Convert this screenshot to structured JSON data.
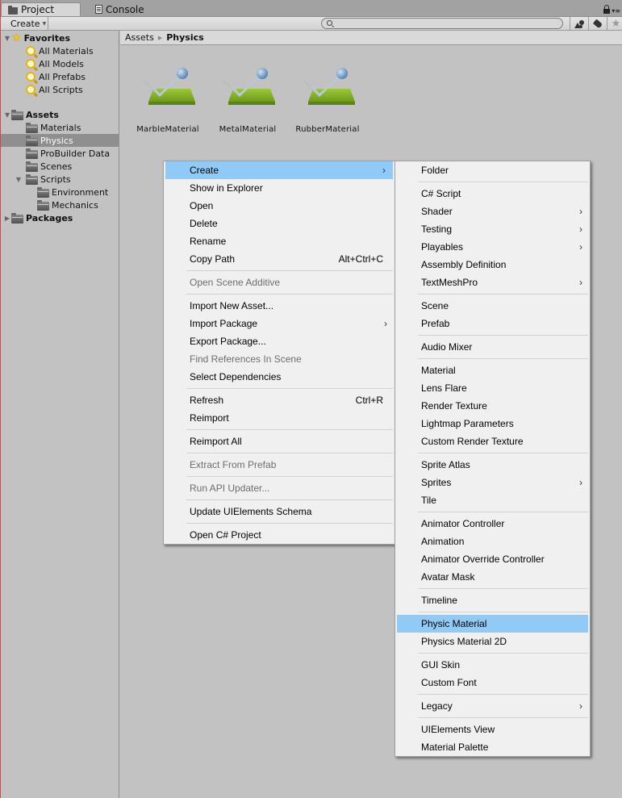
{
  "tabs": [
    {
      "label": "Project",
      "icon": "folder-icon",
      "active": true
    },
    {
      "label": "Console",
      "icon": "console-icon",
      "active": false
    }
  ],
  "toolbar": {
    "create_label": "Create",
    "search_placeholder": "",
    "buttons": [
      "search-by-type-icon",
      "search-by-label-icon",
      "favorite-star-icon"
    ]
  },
  "sidebar": {
    "favorites": {
      "label": "Favorites",
      "items": [
        "All Materials",
        "All Models",
        "All Prefabs",
        "All Scripts"
      ]
    },
    "assets": {
      "label": "Assets",
      "items": [
        {
          "label": "Materials"
        },
        {
          "label": "Physics",
          "selected": true
        },
        {
          "label": "ProBuilder Data"
        },
        {
          "label": "Scenes"
        },
        {
          "label": "Scripts",
          "expanded": true,
          "children": [
            "Environment",
            "Mechanics"
          ]
        }
      ]
    },
    "packages": {
      "label": "Packages"
    }
  },
  "breadcrumb": {
    "root": "Assets",
    "current": "Physics"
  },
  "assets": [
    {
      "name": "MarbleMaterial",
      "icon": "physic-material-icon"
    },
    {
      "name": "MetalMaterial",
      "icon": "physic-material-icon"
    },
    {
      "name": "RubberMaterial",
      "icon": "physic-material-icon"
    }
  ],
  "colors": {
    "highlight": "#91c9f7",
    "selection": "#8f8f8f",
    "panel_bg": "#c2c2c2",
    "menu_bg": "#f0f0f0"
  },
  "context_menu": {
    "groups": [
      [
        {
          "label": "Create",
          "submenu": true,
          "highlighted": true
        },
        {
          "label": "Show in Explorer"
        },
        {
          "label": "Open"
        },
        {
          "label": "Delete"
        },
        {
          "label": "Rename"
        },
        {
          "label": "Copy Path",
          "shortcut": "Alt+Ctrl+C"
        }
      ],
      [
        {
          "label": "Open Scene Additive",
          "disabled": true
        }
      ],
      [
        {
          "label": "Import New Asset..."
        },
        {
          "label": "Import Package",
          "submenu": true
        },
        {
          "label": "Export Package..."
        },
        {
          "label": "Find References In Scene",
          "disabled": true
        },
        {
          "label": "Select Dependencies"
        }
      ],
      [
        {
          "label": "Refresh",
          "shortcut": "Ctrl+R"
        },
        {
          "label": "Reimport"
        }
      ],
      [
        {
          "label": "Reimport All"
        }
      ],
      [
        {
          "label": "Extract From Prefab",
          "disabled": true
        }
      ],
      [
        {
          "label": "Run API Updater...",
          "disabled": true
        }
      ],
      [
        {
          "label": "Update UIElements Schema"
        }
      ],
      [
        {
          "label": "Open C# Project"
        }
      ]
    ]
  },
  "create_submenu": {
    "groups": [
      [
        {
          "label": "Folder"
        }
      ],
      [
        {
          "label": "C# Script"
        },
        {
          "label": "Shader",
          "submenu": true
        },
        {
          "label": "Testing",
          "submenu": true
        },
        {
          "label": "Playables",
          "submenu": true
        },
        {
          "label": "Assembly Definition"
        },
        {
          "label": "TextMeshPro",
          "submenu": true
        }
      ],
      [
        {
          "label": "Scene"
        },
        {
          "label": "Prefab"
        }
      ],
      [
        {
          "label": "Audio Mixer"
        }
      ],
      [
        {
          "label": "Material"
        },
        {
          "label": "Lens Flare"
        },
        {
          "label": "Render Texture"
        },
        {
          "label": "Lightmap Parameters"
        },
        {
          "label": "Custom Render Texture"
        }
      ],
      [
        {
          "label": "Sprite Atlas"
        },
        {
          "label": "Sprites",
          "submenu": true
        },
        {
          "label": "Tile"
        }
      ],
      [
        {
          "label": "Animator Controller"
        },
        {
          "label": "Animation"
        },
        {
          "label": "Animator Override Controller"
        },
        {
          "label": "Avatar Mask"
        }
      ],
      [
        {
          "label": "Timeline"
        }
      ],
      [
        {
          "label": "Physic Material",
          "highlighted": true
        },
        {
          "label": "Physics Material 2D"
        }
      ],
      [
        {
          "label": "GUI Skin"
        },
        {
          "label": "Custom Font"
        }
      ],
      [
        {
          "label": "Legacy",
          "submenu": true
        }
      ],
      [
        {
          "label": "UIElements View"
        },
        {
          "label": "Material Palette"
        }
      ]
    ]
  }
}
